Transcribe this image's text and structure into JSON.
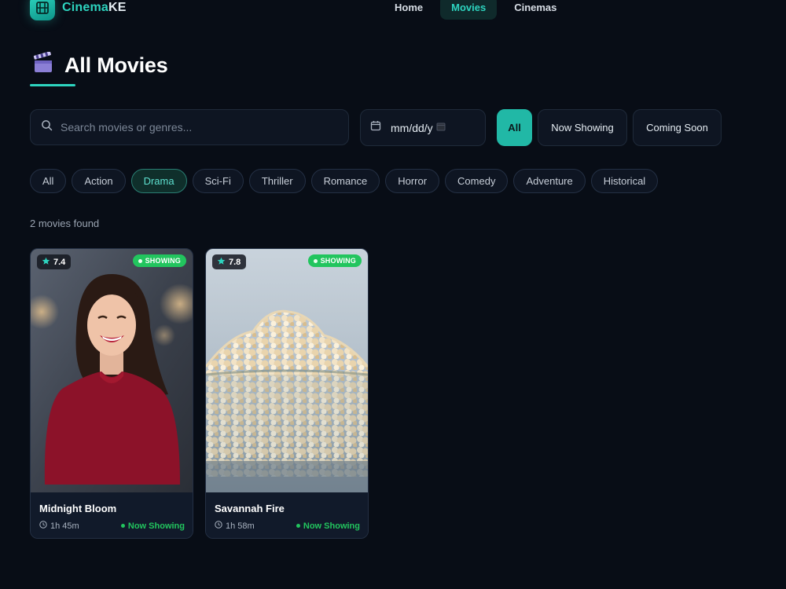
{
  "brand": {
    "name_part1": "Cinema",
    "name_part2": "KE"
  },
  "nav": {
    "items": [
      {
        "label": "Home"
      },
      {
        "label": "Movies"
      },
      {
        "label": "Cinemas"
      }
    ],
    "active": "Movies"
  },
  "page": {
    "title": "All Movies",
    "icon": "clapperboard-icon"
  },
  "search": {
    "placeholder": "Search movies or genres...",
    "value": ""
  },
  "date_filter": {
    "display": "mm/dd/y"
  },
  "status_filters": [
    {
      "label": "All"
    },
    {
      "label": "Now Showing"
    },
    {
      "label": "Coming Soon"
    }
  ],
  "status_active": "All",
  "genres": [
    {
      "label": "All"
    },
    {
      "label": "Action"
    },
    {
      "label": "Drama"
    },
    {
      "label": "Sci-Fi"
    },
    {
      "label": "Thriller"
    },
    {
      "label": "Romance"
    },
    {
      "label": "Horror"
    },
    {
      "label": "Comedy"
    },
    {
      "label": "Adventure"
    },
    {
      "label": "Historical"
    }
  ],
  "genre_active": "Drama",
  "results": {
    "count_text": "2 movies found"
  },
  "movies": [
    {
      "title": "Midnight Bloom",
      "rating": "7.4",
      "badge": "SHOWING",
      "duration": "1h 45m",
      "status": "Now Showing",
      "poster": "smiling-woman-red-sweater"
    },
    {
      "title": "Savannah Fire",
      "rating": "7.8",
      "badge": "SHOWING",
      "duration": "1h 58m",
      "status": "Now Showing",
      "poster": "popcorn-bowl"
    }
  ],
  "colors": {
    "background": "#080d16",
    "accent": "#2dd4bf",
    "active_button": "#21b8a6",
    "showing_green": "#22c55e"
  }
}
